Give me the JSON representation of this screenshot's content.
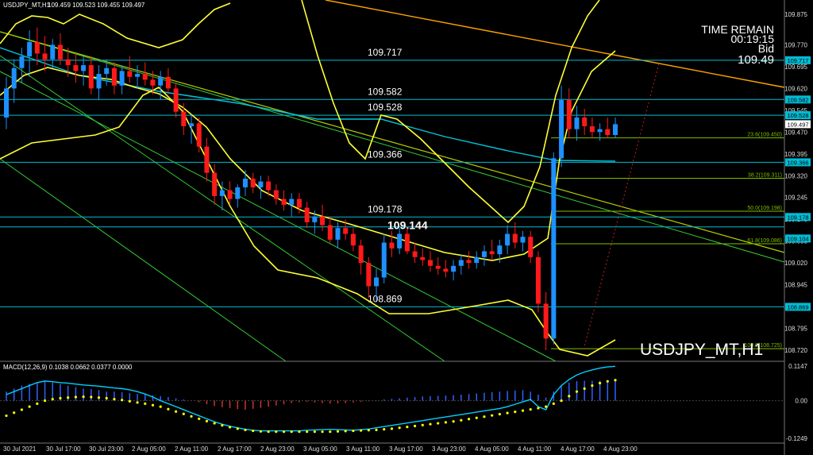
{
  "header": {
    "symbol_tf": "USDJPY_MT,H1",
    "ohlc": "109.459 109.523 109.455 109.497"
  },
  "info_panel": {
    "time_remain_label": "TIME REMAIN",
    "time_remain_value": "00:19:15",
    "bid_label": "Bid",
    "bid_value": "109.49"
  },
  "watermark": "USDJPY_MT,H1",
  "level_labels": [
    {
      "text": "109.717",
      "price": 109.717
    },
    {
      "text": "109.582",
      "price": 109.582
    },
    {
      "text": "109.528",
      "price": 109.528
    },
    {
      "text": "109.366",
      "price": 109.366
    },
    {
      "text": "109.178",
      "price": 109.178
    },
    {
      "text": "109.144",
      "price": 109.144
    },
    {
      "text": "108.869",
      "price": 108.869
    }
  ],
  "price_axis": {
    "ticks": [
      "109.875",
      "109.770",
      "109.695",
      "109.620",
      "109.545",
      "109.470",
      "109.395",
      "109.320",
      "109.245",
      "109.170",
      "109.095",
      "109.020",
      "108.945",
      "108.870",
      "108.795",
      "108.720"
    ],
    "tags": [
      {
        "text": "109.717",
        "color": "#00bcd4"
      },
      {
        "text": "109.582",
        "color": "#00bcd4"
      },
      {
        "text": "109.528",
        "color": "#00bcd4"
      },
      {
        "text": "109.497",
        "color": "#ffffff"
      },
      {
        "text": "109.366",
        "color": "#00bcd4"
      },
      {
        "text": "109.178",
        "color": "#00bcd4"
      },
      {
        "text": "109.104",
        "color": "#00bcd4"
      },
      {
        "text": "108.869",
        "color": "#00bcd4"
      }
    ]
  },
  "fib_labels": [
    {
      "text": "23.6(109.450)",
      "price": 109.45
    },
    {
      "text": "38.2(109.311)",
      "price": 109.311
    },
    {
      "text": "50.0(109.198)",
      "price": 109.198
    },
    {
      "text": "61.8(109.086)",
      "price": 109.086
    },
    {
      "text": "100.0(108.725)",
      "price": 108.725
    }
  ],
  "macd": {
    "label": "MACD(12,26,9) 0.1038 0.0662 0.0377 0.0000",
    "ticks": [
      "0.1147",
      "0.00",
      "-0.1249"
    ],
    "max": 0.1147,
    "min": -0.1249
  },
  "time_axis": [
    "30 Jul 2021",
    "30 Jul 17:00",
    "30 Jul 23:00",
    "2 Aug 05:00",
    "2 Aug 11:00",
    "2 Aug 17:00",
    "2 Aug 23:00",
    "3 Aug 05:00",
    "3 Aug 11:00",
    "3 Aug 17:00",
    "3 Aug 23:00",
    "4 Aug 05:00",
    "4 Aug 11:00",
    "4 Aug 17:00",
    "4 Aug 23:00"
  ],
  "colors": {
    "bull": "#1e90ff",
    "bear": "#ff1a1a",
    "level_line": "#00bcd4",
    "bollinger": "#ffff33",
    "channel": "#33cc33",
    "trendline": "#ffa500",
    "fib": "#7fbf00",
    "macd_hist": "#3060ff",
    "macd_signal": "#ffff00",
    "macd_line": "#00d0ff"
  },
  "candles": [
    [
      109.52,
      109.66,
      109.48,
      109.62
    ],
    [
      109.62,
      109.72,
      109.57,
      109.69
    ],
    [
      109.69,
      109.76,
      109.64,
      109.73
    ],
    [
      109.73,
      109.82,
      109.66,
      109.78
    ],
    [
      109.78,
      109.83,
      109.7,
      109.74
    ],
    [
      109.74,
      109.8,
      109.68,
      109.72
    ],
    [
      109.72,
      109.79,
      109.69,
      109.77
    ],
    [
      109.77,
      109.81,
      109.7,
      109.72
    ],
    [
      109.72,
      109.76,
      109.66,
      109.7
    ],
    [
      109.7,
      109.74,
      109.64,
      109.68
    ],
    [
      109.68,
      109.73,
      109.63,
      109.7
    ],
    [
      109.7,
      109.73,
      109.6,
      109.62
    ],
    [
      109.62,
      109.7,
      109.58,
      109.67
    ],
    [
      109.67,
      109.72,
      109.63,
      109.69
    ],
    [
      109.69,
      109.71,
      109.6,
      109.63
    ],
    [
      109.63,
      109.7,
      109.6,
      109.68
    ],
    [
      109.68,
      109.73,
      109.64,
      109.66
    ],
    [
      109.66,
      109.7,
      109.62,
      109.67
    ],
    [
      109.67,
      109.71,
      109.63,
      109.65
    ],
    [
      109.65,
      109.68,
      109.6,
      109.63
    ],
    [
      109.63,
      109.68,
      109.58,
      109.66
    ],
    [
      109.66,
      109.69,
      109.6,
      109.62
    ],
    [
      109.62,
      109.64,
      109.52,
      109.54
    ],
    [
      109.54,
      109.57,
      109.46,
      109.49
    ],
    [
      109.49,
      109.53,
      109.43,
      109.5
    ],
    [
      109.5,
      109.52,
      109.4,
      109.42
    ],
    [
      109.42,
      109.45,
      109.3,
      109.33
    ],
    [
      109.33,
      109.36,
      109.22,
      109.25
    ],
    [
      109.25,
      109.3,
      109.2,
      109.27
    ],
    [
      109.27,
      109.3,
      109.22,
      109.24
    ],
    [
      109.24,
      109.29,
      109.21,
      109.28
    ],
    [
      109.28,
      109.34,
      109.25,
      109.31
    ],
    [
      109.31,
      109.33,
      109.26,
      109.28
    ],
    [
      109.28,
      109.32,
      109.24,
      109.3
    ],
    [
      109.3,
      109.32,
      109.25,
      109.27
    ],
    [
      109.27,
      109.29,
      109.22,
      109.24
    ],
    [
      109.24,
      109.27,
      109.2,
      109.22
    ],
    [
      109.22,
      109.26,
      109.18,
      109.24
    ],
    [
      109.24,
      109.26,
      109.19,
      109.21
    ],
    [
      109.21,
      109.23,
      109.14,
      109.16
    ],
    [
      109.16,
      109.2,
      109.12,
      109.18
    ],
    [
      109.18,
      109.22,
      109.13,
      109.15
    ],
    [
      109.15,
      109.18,
      109.09,
      109.1
    ],
    [
      109.1,
      109.16,
      109.07,
      109.14
    ],
    [
      109.14,
      109.17,
      109.1,
      109.12
    ],
    [
      109.12,
      109.14,
      109.06,
      109.08
    ],
    [
      109.08,
      109.1,
      108.98,
      109.02
    ],
    [
      109.02,
      109.04,
      108.9,
      108.94
    ],
    [
      108.94,
      109.0,
      108.89,
      108.97
    ],
    [
      108.97,
      109.12,
      108.95,
      109.09
    ],
    [
      109.09,
      109.13,
      109.04,
      109.07
    ],
    [
      109.07,
      109.14,
      109.05,
      109.12
    ],
    [
      109.12,
      109.14,
      109.05,
      109.06
    ],
    [
      109.06,
      109.09,
      109.02,
      109.04
    ],
    [
      109.04,
      109.07,
      109.01,
      109.03
    ],
    [
      109.03,
      109.06,
      108.99,
      109.01
    ],
    [
      109.01,
      109.04,
      108.98,
      109.0
    ],
    [
      109.0,
      109.03,
      108.97,
      108.99
    ],
    [
      108.99,
      109.03,
      108.96,
      109.01
    ],
    [
      109.01,
      109.05,
      108.98,
      109.03
    ],
    [
      109.03,
      109.06,
      109.0,
      109.02
    ],
    [
      109.02,
      109.06,
      109.0,
      109.04
    ],
    [
      109.04,
      109.08,
      109.01,
      109.06
    ],
    [
      109.06,
      109.1,
      109.03,
      109.05
    ],
    [
      109.05,
      109.1,
      109.02,
      109.08
    ],
    [
      109.08,
      109.15,
      109.05,
      109.12
    ],
    [
      109.12,
      109.16,
      109.07,
      109.09
    ],
    [
      109.09,
      109.13,
      109.06,
      109.11
    ],
    [
      109.11,
      109.13,
      109.02,
      109.04
    ],
    [
      109.04,
      109.06,
      108.85,
      108.88
    ],
    [
      108.88,
      108.92,
      108.72,
      108.76
    ],
    [
      108.76,
      109.4,
      108.74,
      109.38
    ],
    [
      109.38,
      109.63,
      109.35,
      109.58
    ],
    [
      109.58,
      109.62,
      109.45,
      109.48
    ],
    [
      109.48,
      109.56,
      109.44,
      109.52
    ],
    [
      109.52,
      109.55,
      109.46,
      109.49
    ],
    [
      109.49,
      109.52,
      109.45,
      109.47
    ],
    [
      109.47,
      109.5,
      109.44,
      109.48
    ],
    [
      109.48,
      109.52,
      109.45,
      109.46
    ],
    [
      109.46,
      109.52,
      109.45,
      109.497
    ]
  ],
  "macd_hist": [
    0.03,
    0.04,
    0.05,
    0.055,
    0.06,
    0.065,
    0.06,
    0.055,
    0.05,
    0.045,
    0.04,
    0.038,
    0.035,
    0.03,
    0.03,
    0.028,
    0.025,
    0.022,
    0.02,
    0.018,
    0.015,
    0.012,
    0.008,
    0.004,
    0.0,
    -0.005,
    -0.012,
    -0.018,
    -0.022,
    -0.025,
    -0.028,
    -0.03,
    -0.027,
    -0.024,
    -0.02,
    -0.016,
    -0.012,
    -0.008,
    -0.005,
    -0.004,
    -0.006,
    -0.008,
    -0.01,
    -0.009,
    -0.008,
    -0.006,
    -0.004,
    -0.002,
    0.001,
    0.004,
    0.006,
    0.008,
    0.01,
    0.012,
    0.014,
    0.015,
    0.016,
    0.017,
    0.018,
    0.02,
    0.022,
    0.024,
    0.026,
    0.028,
    0.03,
    0.032,
    0.034,
    0.035,
    0.03,
    0.02,
    0.01,
    0.03,
    0.05,
    0.06,
    0.065,
    0.066,
    0.066,
    0.066,
    0.066,
    0.066
  ],
  "macd_line": [
    0.02,
    0.03,
    0.04,
    0.05,
    0.06,
    0.065,
    0.063,
    0.06,
    0.058,
    0.055,
    0.052,
    0.05,
    0.048,
    0.045,
    0.042,
    0.04,
    0.036,
    0.03,
    0.022,
    0.012,
    0.0,
    -0.01,
    -0.02,
    -0.03,
    -0.04,
    -0.05,
    -0.06,
    -0.07,
    -0.078,
    -0.085,
    -0.09,
    -0.095,
    -0.098,
    -0.1,
    -0.1,
    -0.1,
    -0.1,
    -0.1,
    -0.1,
    -0.098,
    -0.097,
    -0.096,
    -0.095,
    -0.096,
    -0.097,
    -0.098,
    -0.096,
    -0.094,
    -0.09,
    -0.086,
    -0.082,
    -0.078,
    -0.074,
    -0.07,
    -0.066,
    -0.062,
    -0.058,
    -0.054,
    -0.05,
    -0.046,
    -0.042,
    -0.038,
    -0.034,
    -0.03,
    -0.026,
    -0.02,
    -0.012,
    -0.004,
    0.004,
    -0.02,
    -0.03,
    0.02,
    0.05,
    0.07,
    0.085,
    0.095,
    0.102,
    0.108,
    0.112,
    0.114
  ],
  "macd_signal": [
    -0.05,
    -0.04,
    -0.03,
    -0.02,
    -0.01,
    0.0,
    0.005,
    0.008,
    0.01,
    0.012,
    0.013,
    0.012,
    0.01,
    0.008,
    0.005,
    0.002,
    -0.002,
    -0.006,
    -0.01,
    -0.015,
    -0.02,
    -0.028,
    -0.036,
    -0.044,
    -0.052,
    -0.06,
    -0.068,
    -0.075,
    -0.082,
    -0.088,
    -0.093,
    -0.097,
    -0.1,
    -0.102,
    -0.103,
    -0.103,
    -0.103,
    -0.103,
    -0.103,
    -0.103,
    -0.103,
    -0.103,
    -0.103,
    -0.102,
    -0.101,
    -0.1,
    -0.099,
    -0.098,
    -0.097,
    -0.095,
    -0.093,
    -0.09,
    -0.087,
    -0.084,
    -0.081,
    -0.078,
    -0.075,
    -0.072,
    -0.069,
    -0.065,
    -0.061,
    -0.057,
    -0.053,
    -0.049,
    -0.045,
    -0.041,
    -0.037,
    -0.033,
    -0.029,
    -0.025,
    -0.02,
    -0.01,
    0.0,
    0.015,
    0.03,
    0.04,
    0.05,
    0.058,
    0.064,
    0.068
  ]
}
